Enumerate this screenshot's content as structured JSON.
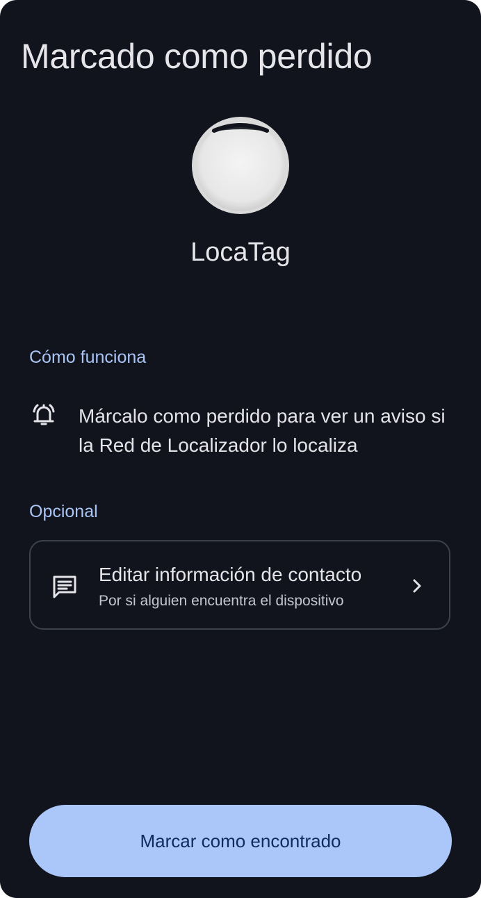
{
  "header": {
    "title": "Marcado como perdido"
  },
  "device": {
    "name": "LocaTag",
    "image_icon": "tag-device-image"
  },
  "how_it_works": {
    "label": "Cómo funciona",
    "icon": "bell-ring-icon",
    "text": "Márcalo como perdido para ver un aviso si la Red de Localizador lo localiza"
  },
  "optional": {
    "label": "Opcional",
    "contact_card": {
      "icon": "message-icon",
      "title": "Editar información de contacto",
      "subtitle": "Por si alguien encuentra el dispositivo",
      "chevron_icon": "chevron-right-icon"
    }
  },
  "actions": {
    "found_button_label": "Marcar como encontrado"
  },
  "colors": {
    "background": "#11141c",
    "accent": "#a9c4f5",
    "button_bg": "#abc7fa",
    "button_text": "#0d2b5c",
    "card_border": "#3d4149"
  }
}
